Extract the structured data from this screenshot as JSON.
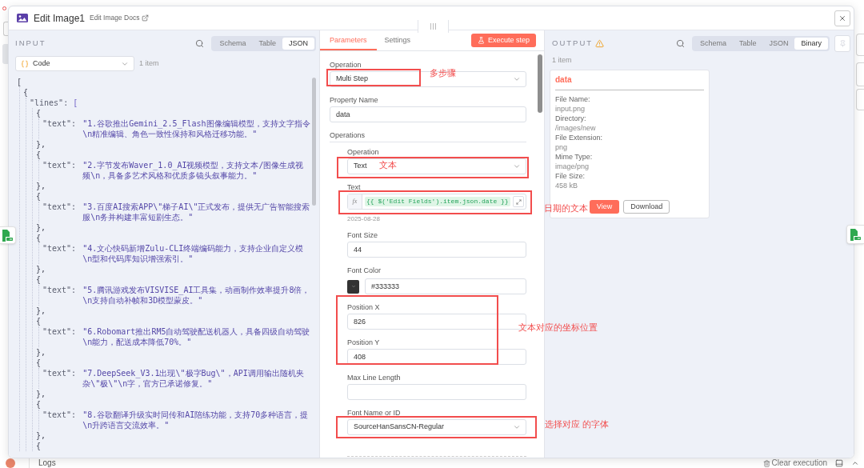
{
  "modal": {
    "title": "Edit Image1",
    "docs_link": "Edit Image Docs"
  },
  "input_panel": {
    "label": "INPUT",
    "view_tabs": [
      {
        "label": "Schema",
        "selected": false
      },
      {
        "label": "Table",
        "selected": false
      },
      {
        "label": "JSON",
        "selected": true
      }
    ],
    "source_select": "Code",
    "item_count": "1 item",
    "code": [
      {
        "text": "[",
        "children": [
          {
            "text": "{",
            "children": [
              {
                "key": "\"lines\":",
                "text": "[",
                "children": [
                  {
                    "text": "{",
                    "children": [
                      {
                        "key": "\"text\":",
                        "value": "\"1.谷歌推出Gemini_2.5_Flash图像编辑模型，支持文字指令\\n精准编辑、角色一致性保持和风格迁移功能。\""
                      }
                    ]
                  },
                  {
                    "text": "},"
                  },
                  {
                    "text": "{",
                    "children": [
                      {
                        "key": "\"text\":",
                        "value": "\"2.字节发布Waver_1.0_AI视频模型，支持文本/图像生成视频\\n，具备多艺术风格和优质多镜头叙事能力。\""
                      }
                    ]
                  },
                  {
                    "text": "},"
                  },
                  {
                    "text": "{",
                    "children": [
                      {
                        "key": "\"text\":",
                        "value": "\"3.百度AI搜索APP\\\"梯子AI\\\"正式发布，提供无广告智能搜索服\\n务并构建丰富短剧生态。\""
                      }
                    ]
                  },
                  {
                    "text": "},"
                  },
                  {
                    "text": "{",
                    "children": [
                      {
                        "key": "\"text\":",
                        "value": "\"4.文心快码新增Zulu-CLI终端编码能力，支持企业自定义模\\n型和代码库知识增强索引。\""
                      }
                    ]
                  },
                  {
                    "text": "},"
                  },
                  {
                    "text": "{",
                    "children": [
                      {
                        "key": "\"text\":",
                        "value": "\"5.腾讯游戏发布VISVISE_AI工具集，动画制作效率提升8倍，\\n支持自动补帧和3D模型蒙皮。\""
                      }
                    ]
                  },
                  {
                    "text": "},"
                  },
                  {
                    "text": "{",
                    "children": [
                      {
                        "key": "\"text\":",
                        "value": "\"6.Robomart推出RM5自动驾驶配送机器人，具备四级自动驾驶\\n能力，配送成本降低70%。\""
                      }
                    ]
                  },
                  {
                    "text": "},"
                  },
                  {
                    "text": "{",
                    "children": [
                      {
                        "key": "\"text\":",
                        "value": "\"7.DeepSeek_V3.1出现\\\"极字Bug\\\"，API调用输出随机夹杂\\\"极\\\"\\n字，官方已承诺修复。\""
                      }
                    ]
                  },
                  {
                    "text": "},"
                  },
                  {
                    "text": "{",
                    "children": [
                      {
                        "key": "\"text\":",
                        "value": "\"8.谷歌翻译升级实时同传和AI陪练功能，支持70多种语言，提\\n升跨语言交流效率。\""
                      }
                    ]
                  },
                  {
                    "text": "},"
                  },
                  {
                    "text": "{"
                  }
                ]
              }
            ]
          }
        ]
      }
    ]
  },
  "parameters_panel": {
    "tabs": [
      {
        "label": "Parameters",
        "selected": true
      },
      {
        "label": "Settings",
        "selected": false
      }
    ],
    "execute_button": "Execute step",
    "fields": [
      {
        "kind": "select",
        "label": "Operation",
        "value": "Multi Step"
      },
      {
        "kind": "input",
        "label": "Property Name",
        "value": "data"
      },
      {
        "kind": "section",
        "label": "Operations",
        "children": [
          {
            "kind": "select",
            "label": "Operation",
            "value": "Text"
          },
          {
            "kind": "expression",
            "label": "Text",
            "prefix": "fx",
            "value": "{{ $('Edit Fields').item.json.date }}",
            "result": "2025-08-28"
          },
          {
            "kind": "input",
            "label": "Font Size",
            "value": "44"
          },
          {
            "kind": "color",
            "label": "Font Color",
            "value": "#333333",
            "color": "#333333"
          },
          {
            "kind": "input",
            "label": "Position X",
            "value": "826"
          },
          {
            "kind": "input",
            "label": "Position Y",
            "value": "408"
          },
          {
            "kind": "input",
            "label": "Max Line Length"
          },
          {
            "kind": "select",
            "label": "Font Name or ID",
            "value": "SourceHanSansCN-Regular"
          }
        ]
      }
    ]
  },
  "output_panel": {
    "label": "OUTPUT",
    "warning": true,
    "view_tabs": [
      {
        "label": "Schema",
        "selected": false
      },
      {
        "label": "Table",
        "selected": false
      },
      {
        "label": "JSON",
        "selected": false
      },
      {
        "label": "Binary",
        "selected": true
      }
    ],
    "pin": {
      "disabled": true
    },
    "item_count": "1 item",
    "binary": {
      "title": "data",
      "properties": [
        {
          "label": "File Name:",
          "value": "input.png"
        },
        {
          "label": "Directory:",
          "value": "/images/new"
        },
        {
          "label": "File Extension:",
          "value": "png"
        },
        {
          "label": "Mime Type:",
          "value": "image/png"
        },
        {
          "label": "File Size:",
          "value": "458 kB"
        }
      ],
      "buttons": [
        {
          "label": "View",
          "kind": "primary"
        },
        {
          "label": "Download",
          "kind": "secondary"
        }
      ]
    }
  },
  "annotations": [
    {
      "text": "多步骤"
    },
    {
      "text": "文本"
    },
    {
      "text": "日期的文本"
    },
    {
      "text": "文本对应的坐标位置"
    },
    {
      "text": "选择对应 的字体"
    }
  ],
  "footer": {
    "logs": "Logs",
    "clear_execution": "Clear execution"
  }
}
